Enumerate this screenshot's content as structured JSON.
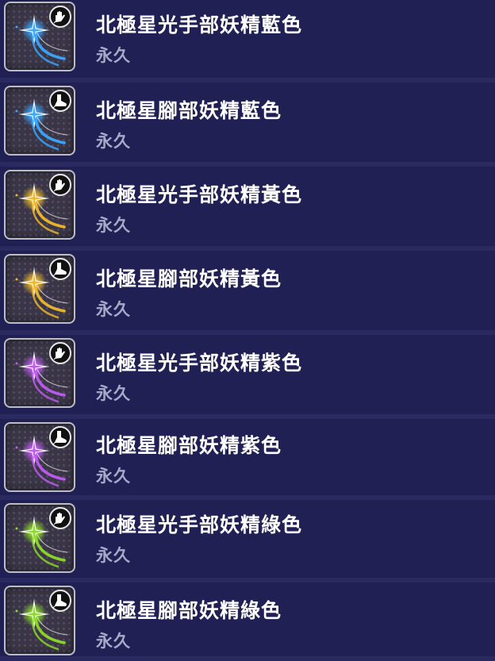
{
  "items": [
    {
      "title": "北極星光手部妖精藍色",
      "duration": "永久",
      "color": "#3aa8ff",
      "slot_icon": "glove-icon"
    },
    {
      "title": "北極星腳部妖精藍色",
      "duration": "永久",
      "color": "#3aa8ff",
      "slot_icon": "boot-icon"
    },
    {
      "title": "北極星光手部妖精黃色",
      "duration": "永久",
      "color": "#f0b92c",
      "slot_icon": "glove-icon"
    },
    {
      "title": "北極星腳部妖精黃色",
      "duration": "永久",
      "color": "#f0b92c",
      "slot_icon": "boot-icon"
    },
    {
      "title": "北極星光手部妖精紫色",
      "duration": "永久",
      "color": "#c05cf0",
      "slot_icon": "glove-icon"
    },
    {
      "title": "北極星腳部妖精紫色",
      "duration": "永久",
      "color": "#c05cf0",
      "slot_icon": "boot-icon"
    },
    {
      "title": "北極星光手部妖精綠色",
      "duration": "永久",
      "color": "#8edb2a",
      "slot_icon": "glove-icon"
    },
    {
      "title": "北極星腳部妖精綠色",
      "duration": "永久",
      "color": "#8edb2a",
      "slot_icon": "boot-icon"
    }
  ]
}
